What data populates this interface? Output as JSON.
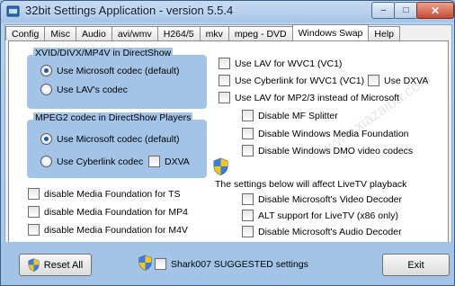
{
  "window": {
    "title": "32bit Settings Application - version 5.5.4"
  },
  "titlebar_buttons": {
    "minimize": "–",
    "maximize": "□",
    "close": "✕"
  },
  "tabs": [
    {
      "label": "Config"
    },
    {
      "label": "Misc"
    },
    {
      "label": "Audio"
    },
    {
      "label": "avi/wmv"
    },
    {
      "label": "H264/5"
    },
    {
      "label": "mkv"
    },
    {
      "label": "mpeg - DVD"
    },
    {
      "label": "Windows Swap",
      "active": true
    },
    {
      "label": "Help"
    }
  ],
  "xvid_group": {
    "title": "XVID/DIVX/MP4V in DirectShow",
    "options": [
      {
        "label": "Use Microsoft codec (default)",
        "selected": true
      },
      {
        "label": "Use LAV's codec",
        "selected": false
      }
    ]
  },
  "mpeg2_group": {
    "title": "MPEG2 codec in DirectShow Players",
    "options": [
      {
        "label": "Use Microsoft codec (default)",
        "selected": true
      },
      {
        "label": "Use Cyberlink codec",
        "selected": false
      }
    ],
    "dxva_label": "DXVA"
  },
  "media_foundation": [
    {
      "label": "disable Media Foundation for TS",
      "checked": false
    },
    {
      "label": "disable Media Foundation for MP4",
      "checked": false
    },
    {
      "label": "disable Media Foundation for M4V",
      "checked": false
    }
  ],
  "right_options": {
    "lav_vc1": "Use LAV for WVC1 (VC1)",
    "cyberlink_vc1": "Use Cyberlink for WVC1 (VC1)",
    "use_dxva": "Use DXVA",
    "lav_mp23": "Use LAV for MP2/3 instead of Microsoft",
    "disable_mf_splitter": "Disable MF Splitter",
    "disable_wmf": "Disable Windows Media Foundation",
    "disable_dmo": "Disable Windows DMO video codecs",
    "livetv_note": "The settings below will affect LiveTV playback",
    "disable_ms_video_decoder": "Disable Microsoft's Video Decoder",
    "alt_support": "ALT support for LiveTV (x86 only)",
    "disable_ms_audio_decoder": "Disable Microsoft's Audio Decoder"
  },
  "bottom": {
    "reset_label": "Reset All",
    "suggested_label": "Shark007 SUGGESTED settings",
    "exit_label": "Exit"
  },
  "watermark": "www.xiazaiba.com",
  "colors": {
    "panel_blue": "#a3c4e6",
    "frame_blue": "#b9d3ef",
    "radio_dot": "#1f55b5"
  }
}
